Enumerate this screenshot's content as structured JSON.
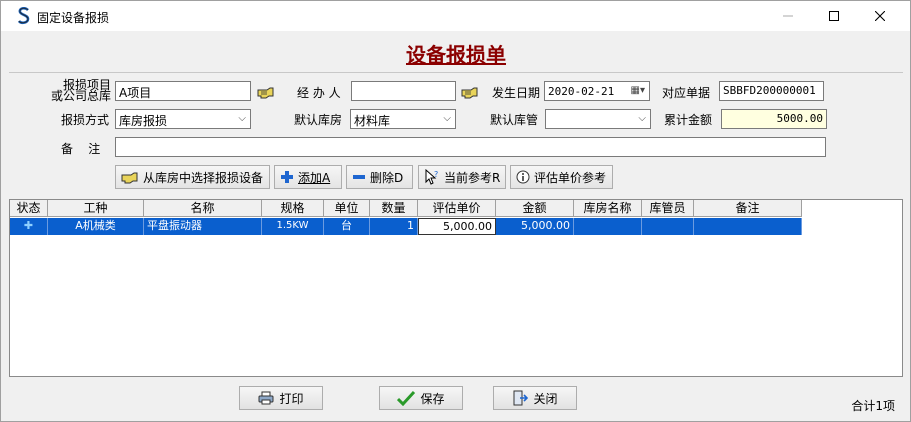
{
  "window": {
    "title": "固定设备报损",
    "icon": "app-s-icon"
  },
  "form": {
    "heading": "设备报损单",
    "project_label_1": "报损项目",
    "project_label_2": "或公司总库",
    "project_value": "A项目",
    "handler_label": "经 办 人",
    "handler_value": "",
    "date_label": "发生日期",
    "date_value": "2020-02-21",
    "ref_label": "对应单据",
    "ref_value": "SBBFD200000001",
    "method_label": "报损方式",
    "method_value": "库房报损",
    "warehouse_label": "默认库房",
    "warehouse_value": "材料库",
    "keeper_label": "默认库管",
    "keeper_value": "",
    "total_amount_label": "累计金额",
    "total_amount_value": "5000.00",
    "remark_label": "备    注",
    "remark_value": ""
  },
  "toolbar": {
    "select_from_warehouse": "从库房中选择报损设备",
    "add": "添加A",
    "delete": "删除D",
    "current_ref": "当前参考R",
    "eval_price_ref": "评估单价参考"
  },
  "grid": {
    "columns": [
      "状态",
      "工种",
      "名称",
      "规格",
      "单位",
      "数量",
      "评估单价",
      "金额",
      "库房名称",
      "库管员",
      "备注"
    ],
    "rows": [
      {
        "status": "✚",
        "work_type": "A机械类",
        "name": "平盘振动器",
        "spec": "1.5KW",
        "unit": "台",
        "qty": "1",
        "eval_price": "5,000.00",
        "amount": "5,000.00",
        "warehouse": "",
        "keeper": "",
        "remark": ""
      }
    ]
  },
  "footer": {
    "print": "打印",
    "save": "保存",
    "close": "关闭",
    "total_count": "合计1项"
  },
  "colors": {
    "heading": "#8b0000",
    "selection": "#0a5fce",
    "amount_bg": "#ffffe0"
  }
}
